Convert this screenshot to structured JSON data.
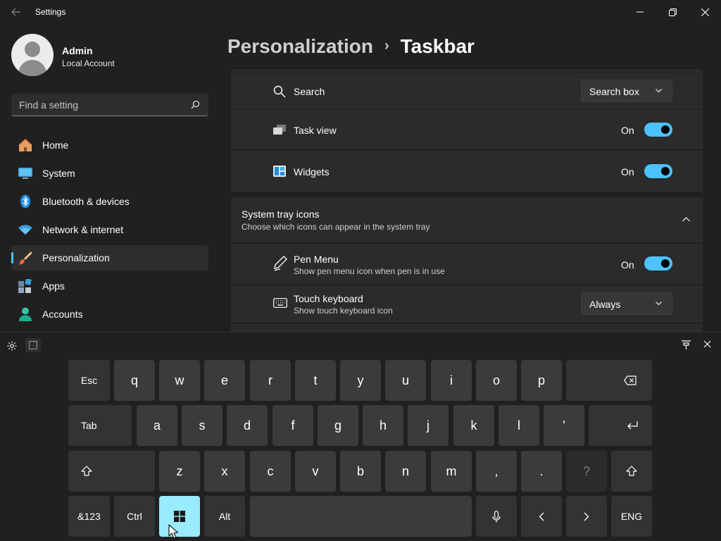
{
  "window": {
    "title": "Settings",
    "back_icon": "arrow-left-icon",
    "controls": [
      "minimize-icon",
      "restore-icon",
      "close-icon"
    ]
  },
  "profile": {
    "name": "Admin",
    "account_type": "Local Account"
  },
  "search": {
    "placeholder": "Find a setting"
  },
  "sidebar": {
    "items": [
      {
        "label": "Home",
        "icon": "home-icon"
      },
      {
        "label": "System",
        "icon": "monitor-icon"
      },
      {
        "label": "Bluetooth & devices",
        "icon": "bluetooth-icon"
      },
      {
        "label": "Network & internet",
        "icon": "wifi-icon"
      },
      {
        "label": "Personalization",
        "icon": "brush-icon",
        "active": true
      },
      {
        "label": "Apps",
        "icon": "apps-icon"
      },
      {
        "label": "Accounts",
        "icon": "person-icon"
      }
    ]
  },
  "breadcrumb": {
    "parent": "Personalization",
    "separator": "›",
    "current": "Taskbar"
  },
  "taskbar_items": {
    "search": {
      "label": "Search",
      "value": "Search box"
    },
    "task_view": {
      "label": "Task view",
      "state": "On"
    },
    "widgets": {
      "label": "Widgets",
      "state": "On"
    }
  },
  "system_tray": {
    "title": "System tray icons",
    "subtitle": "Choose which icons can appear in the system tray",
    "pen_menu": {
      "label": "Pen Menu",
      "description": "Show pen menu icon when pen is in use",
      "state": "On"
    },
    "touch_keyboard": {
      "label": "Touch keyboard",
      "description": "Show touch keyboard icon",
      "value": "Always"
    }
  },
  "keyboard": {
    "row1": [
      "Esc",
      "q",
      "w",
      "e",
      "r",
      "t",
      "y",
      "u",
      "i",
      "o",
      "p"
    ],
    "row2": [
      "Tab",
      "a",
      "s",
      "d",
      "f",
      "g",
      "h",
      "j",
      "k",
      "l",
      "'"
    ],
    "row3": [
      "z",
      "x",
      "c",
      "v",
      "b",
      "n",
      "m",
      ",",
      ".",
      "?"
    ],
    "row4": {
      "symbols": "&123",
      "ctrl": "Ctrl",
      "alt": "Alt",
      "lang": "ENG"
    }
  },
  "colors": {
    "accent": "#4cc2ff",
    "window_key_highlight": "#99ebff",
    "background": "#202020",
    "card": "#2b2b2b"
  }
}
